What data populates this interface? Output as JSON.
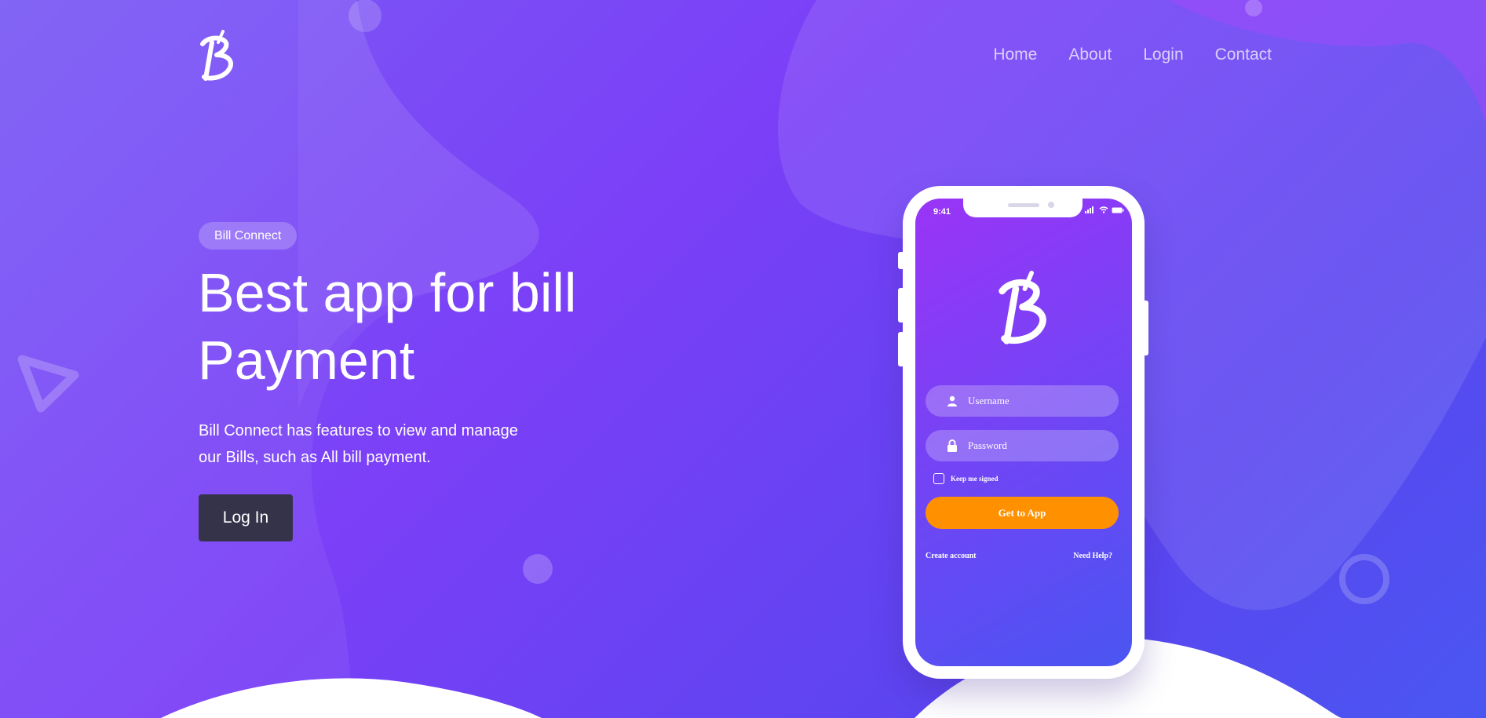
{
  "brand": {
    "logo_icon": "bill-connect-logo"
  },
  "nav": {
    "items": [
      "Home",
      "About",
      "Login",
      "Contact"
    ]
  },
  "hero": {
    "badge": "Bill Connect",
    "headline_line1": "Best app for bill",
    "headline_line2": "Payment",
    "description_line1": "Bill Connect has features to view and manage",
    "description_line2": "our Bills, such as All bill payment.",
    "login_button": "Log In"
  },
  "phone": {
    "status_time": "9:41",
    "username_placeholder": "Username",
    "password_placeholder": "Password",
    "keep_signed": "Keep me signed",
    "get_to_app": "Get to App",
    "create_account": "Create account",
    "need_help": "Need Help?"
  },
  "colors": {
    "background_start": "#7b5cf5",
    "background_end": "#4a56f1",
    "accent_button": "#ff9100",
    "dark_button": "#35334a"
  }
}
